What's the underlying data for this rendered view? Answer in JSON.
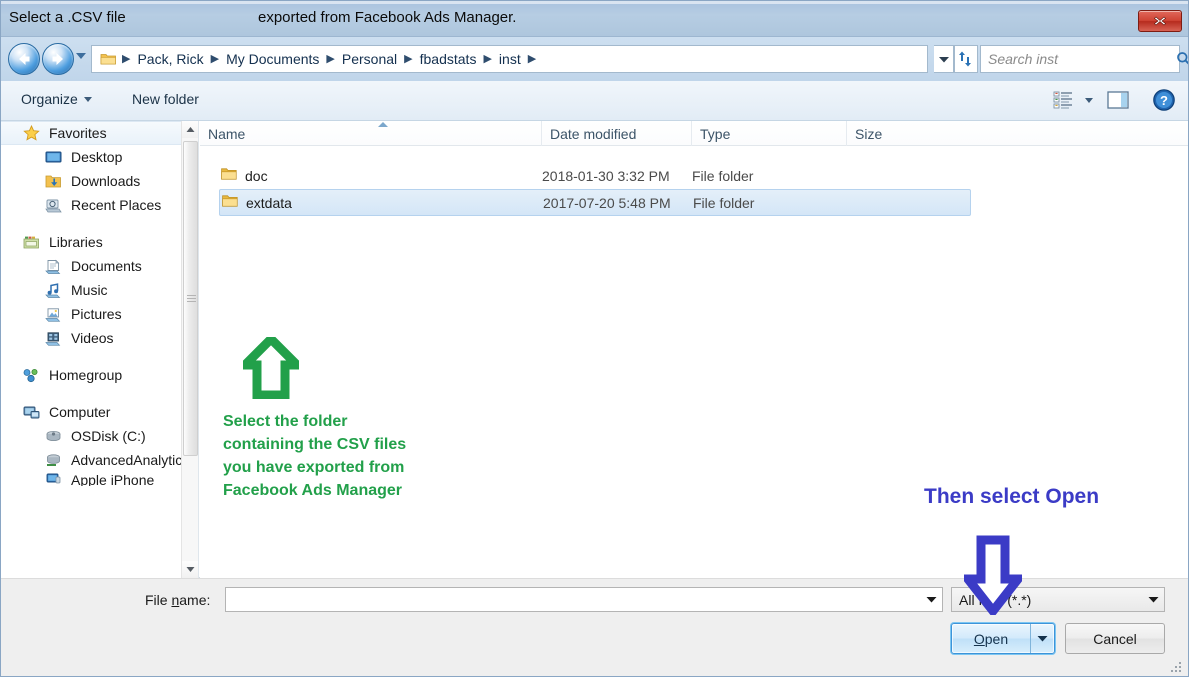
{
  "window": {
    "title_main": "Select a .CSV file",
    "title_sub": "exported from Facebook Ads Manager.",
    "close_icon": "close-x-icon"
  },
  "address_bar": {
    "back_icon": "back-arrow-icon",
    "forward_icon": "forward-arrow-icon",
    "recent_icon": "recent-pages-chevron-icon",
    "folder_icon": "folder-icon",
    "crumbs": [
      {
        "label": "Pack, Rick"
      },
      {
        "label": "My Documents"
      },
      {
        "label": "Personal"
      },
      {
        "label": "fbadstats"
      },
      {
        "label": "inst"
      }
    ],
    "dropdown_icon": "chevron-down-icon",
    "refresh_icon": "refresh-icon",
    "search": {
      "placeholder": "Search inst",
      "value": "",
      "icon": "search-icon"
    }
  },
  "toolbar": {
    "organize_label": "Organize",
    "organize_caret_icon": "chevron-down-icon",
    "new_folder_label": "New folder",
    "view_icon": "list-view-icon",
    "view_caret_icon": "chevron-down-icon",
    "preview_pane_icon": "preview-pane-icon",
    "help_icon": "help-question-icon"
  },
  "sidebar": {
    "groups": [
      {
        "header": {
          "label": "Favorites",
          "icon": "star-icon",
          "selected": true
        },
        "items": [
          {
            "label": "Desktop",
            "icon": "desktop-icon"
          },
          {
            "label": "Downloads",
            "icon": "downloads-folder-icon"
          },
          {
            "label": "Recent Places",
            "icon": "recent-places-icon"
          }
        ]
      },
      {
        "header": {
          "label": "Libraries",
          "icon": "libraries-icon",
          "selected": false
        },
        "items": [
          {
            "label": "Documents",
            "icon": "documents-library-icon"
          },
          {
            "label": "Music",
            "icon": "music-library-icon"
          },
          {
            "label": "Pictures",
            "icon": "pictures-library-icon"
          },
          {
            "label": "Videos",
            "icon": "videos-library-icon"
          }
        ]
      },
      {
        "header": {
          "label": "Homegroup",
          "icon": "homegroup-icon",
          "selected": false
        },
        "items": []
      },
      {
        "header": {
          "label": "Computer",
          "icon": "computer-icon",
          "selected": false
        },
        "items": [
          {
            "label": "OSDisk (C:)",
            "icon": "hard-drive-icon"
          },
          {
            "label": "AdvancedAnalytic",
            "icon": "network-drive-icon"
          },
          {
            "label": "Apple iPhone",
            "icon": "portable-device-icon"
          }
        ]
      }
    ],
    "scrollbar": {
      "up_icon": "scroll-up-arrow-icon",
      "down_icon": "scroll-down-arrow-icon"
    }
  },
  "file_list": {
    "columns": [
      "Name",
      "Date modified",
      "Type",
      "Size"
    ],
    "sort_indicator_icon": "sort-ascending-icon",
    "rows": [
      {
        "name": "doc",
        "date_modified": "2018-01-30 3:32 PM",
        "type": "File folder",
        "size": "",
        "icon": "folder-icon",
        "selected": false
      },
      {
        "name": "extdata",
        "date_modified": "2017-07-20 5:48 PM",
        "type": "File folder",
        "size": "",
        "icon": "folder-icon",
        "selected": true
      }
    ]
  },
  "annotations": {
    "green": {
      "color": "#22a04a",
      "arrow_icon": "up-arrow-annotation-icon",
      "lines": [
        "Select the folder",
        "containing the CSV files",
        "you have exported from",
        "Facebook Ads Manager"
      ]
    },
    "blue": {
      "color": "#3b3bc6",
      "text": "Then select Open",
      "arrow_icon": "down-arrow-annotation-icon"
    }
  },
  "footer": {
    "file_name_label_before": "File ",
    "file_name_label_accel": "n",
    "file_name_label_after": "ame:",
    "file_name_value": "",
    "file_name_caret_icon": "chevron-down-icon",
    "file_type_value": "All files (*.*)",
    "file_type_caret_icon": "chevron-down-icon",
    "open_label_accel": "O",
    "open_label_rest": "pen",
    "open_split_icon": "chevron-down-icon",
    "cancel_label": "Cancel",
    "resize_grip_icon": "resize-grip-icon"
  }
}
